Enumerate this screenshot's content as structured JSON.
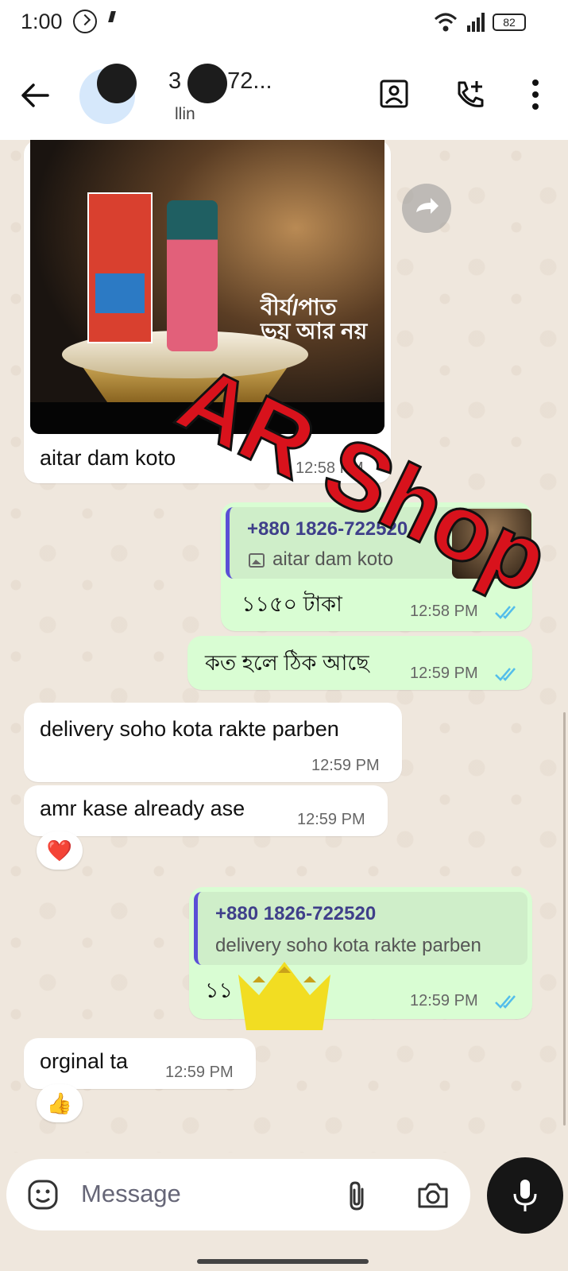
{
  "status_bar": {
    "time": "1:00",
    "battery": "82"
  },
  "header": {
    "name": "3    6-72...",
    "subtitle": "llin"
  },
  "messages": {
    "img_caption": "aitar dam koto",
    "img_time": "12:58 PM",
    "photo_text": "বীর্য/পাত ভয় আর নয়",
    "reply1_quote_name": "+880 1826-722520",
    "reply1_quote_text": "aitar dam koto",
    "reply1_text": "১১৫০ টাকা",
    "reply1_time": "12:58 PM",
    "out2_text": "কত হলে ঠিক আছে",
    "out2_time": "12:59 PM",
    "in3_text": "delivery soho kota rakte parben",
    "in3_time": "12:59 PM",
    "in4_text": "amr kase already ase",
    "in4_time": "12:59 PM",
    "in4_reaction": "❤️",
    "reply2_quote_name": "+880 1826-722520",
    "reply2_quote_text": "delivery soho kota rakte parben",
    "reply2_text": "১১",
    "reply2_time": "12:59 PM",
    "in5_text": "orginal ta",
    "in5_time": "12:59 PM",
    "in5_reaction": "👍"
  },
  "watermark": "AR Shop",
  "input": {
    "placeholder": "Message"
  },
  "icons": [
    "back-arrow-icon",
    "video-call-icon",
    "add-call-icon",
    "more-options-icon",
    "forward-icon",
    "emoji-icon",
    "attach-icon",
    "camera-icon",
    "mic-icon"
  ],
  "colors": {
    "outgoing": "#d9fdd3",
    "incoming": "#ffffff",
    "read_ticks": "#53bdeb",
    "quote_bar": "#5b4fd6",
    "watermark": "#d8121c"
  }
}
